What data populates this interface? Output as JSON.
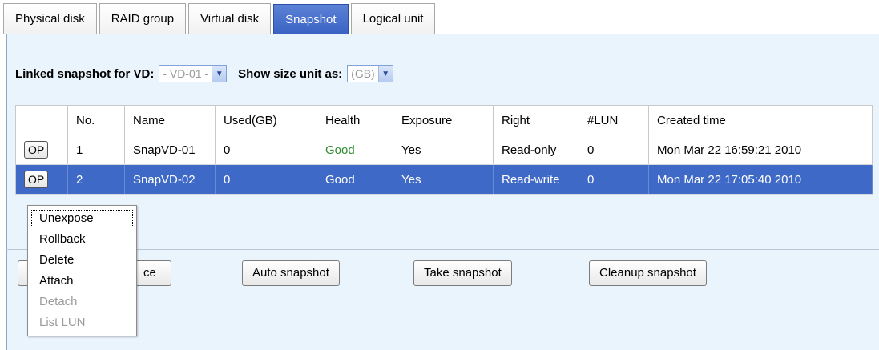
{
  "tabs": [
    {
      "label": "Physical disk",
      "active": false
    },
    {
      "label": "RAID group",
      "active": false
    },
    {
      "label": "Virtual disk",
      "active": false
    },
    {
      "label": "Snapshot",
      "active": true
    },
    {
      "label": "Logical unit",
      "active": false
    }
  ],
  "filters": {
    "linked_label": "Linked snapshot for VD:",
    "linked_value": "- VD-01 -",
    "unit_label": "Show size unit as:",
    "unit_value": "(GB)"
  },
  "table": {
    "headers": [
      "",
      "No.",
      "Name",
      "Used(GB)",
      "Health",
      "Exposure",
      "Right",
      "#LUN",
      "Created time"
    ],
    "rows": [
      {
        "op": "OP",
        "no": "1",
        "name": "SnapVD-01",
        "used": "0",
        "health": "Good",
        "exposure": "Yes",
        "right": "Read-only",
        "lun": "0",
        "created": "Mon Mar 22 16:59:21 2010",
        "selected": false
      },
      {
        "op": "OP",
        "no": "2",
        "name": "SnapVD-02",
        "used": "0",
        "health": "Good",
        "exposure": "Yes",
        "right": "Read-write",
        "lun": "0",
        "created": "Mon Mar 22 17:05:40 2010",
        "selected": true
      }
    ]
  },
  "op_menu": {
    "items": [
      {
        "label": "Unexpose",
        "enabled": true
      },
      {
        "label": "Rollback",
        "enabled": true
      },
      {
        "label": "Delete",
        "enabled": true
      },
      {
        "label": "Attach",
        "enabled": true
      },
      {
        "label": "Detach",
        "enabled": false
      },
      {
        "label": "List LUN",
        "enabled": false
      }
    ]
  },
  "buttons": {
    "space_partial": "ce",
    "auto_snapshot": "Auto snapshot",
    "take_snapshot": "Take snapshot",
    "cleanup_snapshot": "Cleanup snapshot"
  },
  "colors": {
    "accent": "#3f69c7",
    "panel_bg": "#eaf4fc",
    "health_good": "#2e8b2e"
  }
}
